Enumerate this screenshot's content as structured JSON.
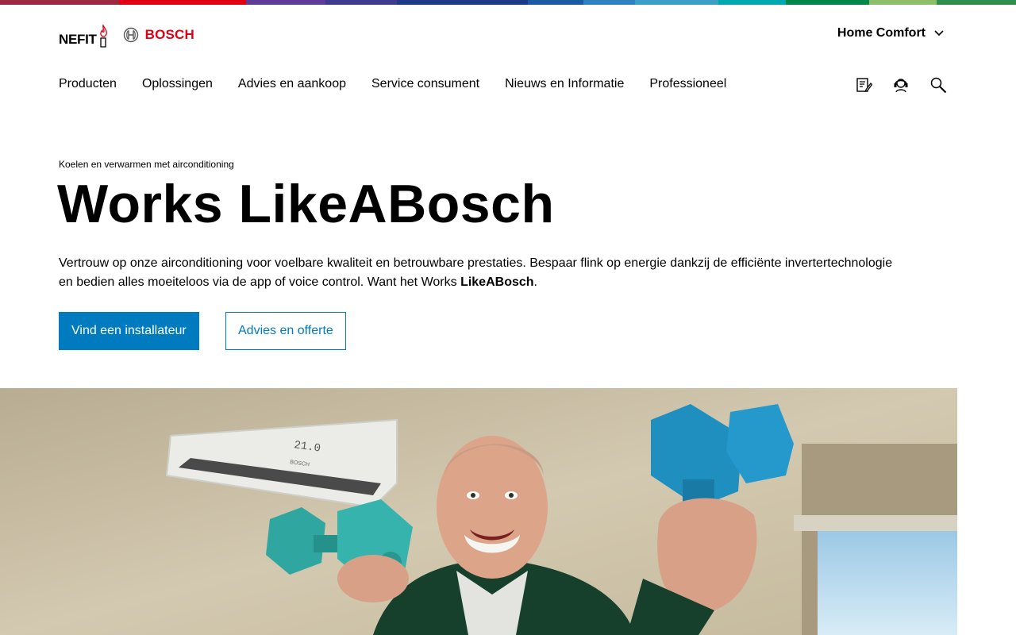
{
  "supergraphic_colors": [
    "#9c2842",
    "#e20015",
    "#e20015",
    "#5f3c97",
    "#1d3a88",
    "#1b5aa5",
    "#2f81c4",
    "#3aa0c8",
    "#00a8b0",
    "#00884a",
    "#8dbf6a",
    "#2f8f4a"
  ],
  "brand": {
    "nefit_logo": "NEFIT",
    "bosch_logo": "BOSCH",
    "bosch_color": "#e20015"
  },
  "header": {
    "region_label": "Home Comfort",
    "region_icon": "chevron-down-icon"
  },
  "nav": {
    "items": [
      {
        "label": "Producten"
      },
      {
        "label": "Oplossingen"
      },
      {
        "label": "Advies en aankoop"
      },
      {
        "label": "Service consument"
      },
      {
        "label": "Nieuws en Informatie"
      },
      {
        "label": "Professioneel"
      }
    ],
    "utility_icons": [
      "checklist-icon",
      "dealer-icon",
      "search-icon"
    ]
  },
  "hero": {
    "eyebrow": "Koelen en verwarmen met airconditioning",
    "title": "Works LikeABosch",
    "intro_text": "Vertrouw op onze airconditioning voor voelbare kwaliteit en betrouwbare prestaties. Bespaar flink op energie dankzij de efficiënte invertertechnologie en bedien alles moeiteloos via de app of voice control. Want het Works ",
    "intro_bold": "LikeABosch",
    "intro_end": ".",
    "primary_cta": "Vind een installateur",
    "secondary_cta": "Advies en offerte",
    "accent_color": "#007bc0"
  },
  "image": {
    "ac_display": "21.0",
    "ac_brand": "BOSCH"
  }
}
